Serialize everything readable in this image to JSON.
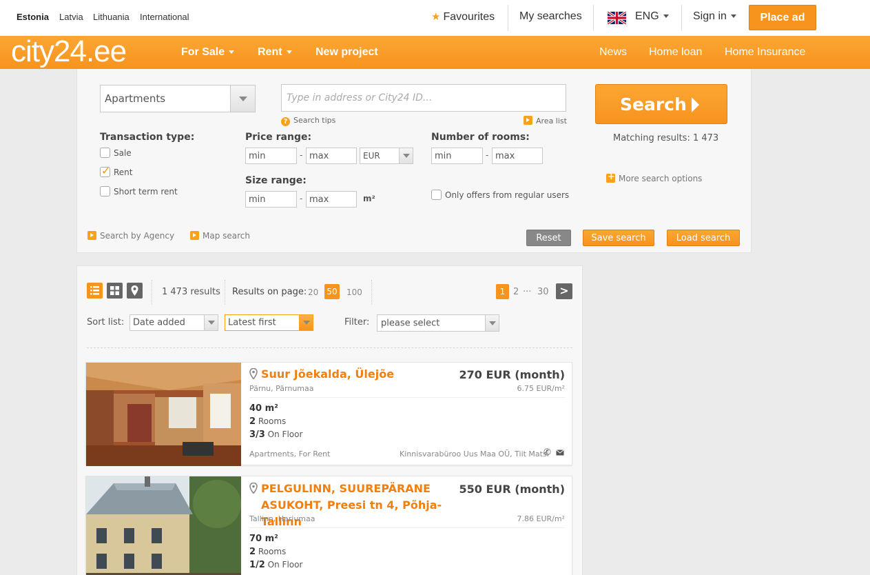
{
  "countries": [
    "Estonia",
    "Latvia",
    "Lithuania",
    "International"
  ],
  "topnav": {
    "favourites": "Favourites",
    "my_searches": "My searches",
    "language": "ENG",
    "sign_in": "Sign in",
    "place_ad": "Place ad"
  },
  "logo": {
    "main": "city24",
    "ext": ".ee"
  },
  "mainnav": {
    "for_sale": "For Sale",
    "rent": "Rent",
    "new_project": "New project",
    "news": "News",
    "home_loan": "Home loan",
    "home_insurance": "Home Insurance"
  },
  "search": {
    "property_type": "Apartments",
    "address_placeholder": "Type in address or City24 ID...",
    "search_tips": "Search tips",
    "area_list": "Area list",
    "button": "Search",
    "matching": "Matching results: 1 473",
    "transaction_label": "Transaction type:",
    "transactions": [
      {
        "label": "Sale",
        "checked": false
      },
      {
        "label": "Rent",
        "checked": true
      },
      {
        "label": "Short term rent",
        "checked": false
      }
    ],
    "price_label": "Price range:",
    "price_min": "min",
    "price_max": "max",
    "currency": "EUR",
    "rooms_label": "Number of rooms:",
    "rooms_min": "min",
    "rooms_max": "max",
    "size_label": "Size range:",
    "size_min": "min",
    "size_max": "max",
    "size_unit": "m²",
    "regular_users": "Only offers from regular users",
    "more_options": "More search options",
    "by_agency": "Search by Agency",
    "map_search": "Map search",
    "reset": "Reset",
    "save": "Save search",
    "load": "Load search",
    "dash": "-"
  },
  "results": {
    "count": "1 473 results",
    "per_page_label": "Results on page:",
    "per_page": [
      "20",
      "50",
      "100"
    ],
    "per_page_selected": "50",
    "pages": [
      "1",
      "2",
      "···",
      "30"
    ],
    "next": ">",
    "sort_label": "Sort list:",
    "sort_by": "Date added",
    "sort_order": "Latest first",
    "filter_label": "Filter:",
    "filter_value": "please select"
  },
  "listings": [
    {
      "title": "Suur Jõekalda, Ülejõe",
      "location": "Pärnu, Pärnumaa",
      "price": "270 EUR (month)",
      "price_m2": "6.75 EUR/m²",
      "size": "40 m²",
      "rooms_n": "2",
      "rooms_label": "Rooms",
      "floor_n": "3/3",
      "floor_label": "On Floor",
      "category": "Apartments, For Rent",
      "agency": "Kinnisvarabüroo Uus Maa OÜ, Tiit Matsi"
    },
    {
      "title": "PELGULINN, SUUREPÄRANE ASUKOHT, Preesi tn 4, Põhja-Tallinn",
      "location": "Tallinn, Harjumaa",
      "price": "550 EUR (month)",
      "price_m2": "7.86 EUR/m²",
      "size": "70 m²",
      "rooms_n": "2",
      "rooms_label": "Rooms",
      "floor_n": "1/2",
      "floor_label": "On Floor"
    }
  ],
  "colors": {
    "accent": "#f7941d",
    "title": "#f07f0e",
    "grey_button": "#888888"
  }
}
